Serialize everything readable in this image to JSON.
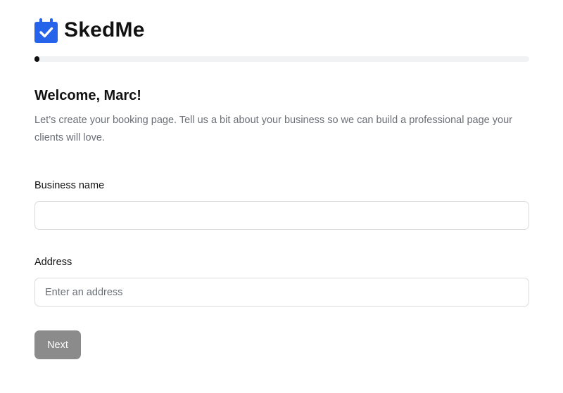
{
  "app": {
    "brand_name": "SkedMe",
    "logo_icon": "calendar-check-icon",
    "brand_color": "#2563eb"
  },
  "progress": {
    "fraction": 0.01
  },
  "welcome": {
    "title": "Welcome, Marc!",
    "description": "Let’s create your booking page. Tell us a bit about your business so we can build a professional page your clients will love."
  },
  "form": {
    "business_name": {
      "label": "Business name",
      "value": "",
      "placeholder": ""
    },
    "address": {
      "label": "Address",
      "value": "",
      "placeholder": "Enter an address"
    },
    "next_label": "Next",
    "next_button_color": "#8b8b8b"
  }
}
